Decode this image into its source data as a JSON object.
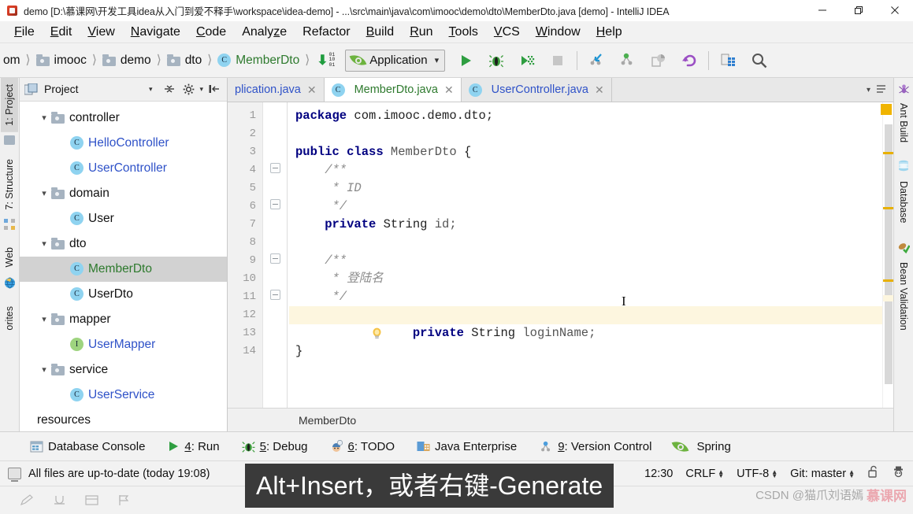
{
  "window": {
    "title": "demo [D:\\慕课网\\开发工具idea从入门到爱不释手\\workspace\\idea-demo] - ...\\src\\main\\java\\com\\imooc\\demo\\dto\\MemberDto.java [demo] - IntelliJ IDEA",
    "minimize_label": "─",
    "maximize_label": "❐",
    "close_label": "✕",
    "app_icon": "intellij-idea-icon"
  },
  "menubar": [
    {
      "label": "File",
      "accel": "F"
    },
    {
      "label": "Edit",
      "accel": "E"
    },
    {
      "label": "View",
      "accel": "V"
    },
    {
      "label": "Navigate",
      "accel": "N"
    },
    {
      "label": "Code",
      "accel": "C"
    },
    {
      "label": "Analyze",
      "accel": ""
    },
    {
      "label": "Refactor",
      "accel": ""
    },
    {
      "label": "Build",
      "accel": "B"
    },
    {
      "label": "Run",
      "accel": "R"
    },
    {
      "label": "Tools",
      "accel": "T"
    },
    {
      "label": "VCS",
      "accel": "V"
    },
    {
      "label": "Window",
      "accel": "W"
    },
    {
      "label": "Help",
      "accel": "H"
    }
  ],
  "navbar": {
    "breadcrumbs": [
      {
        "label": "om",
        "icon": "none",
        "style": "plain"
      },
      {
        "label": "imooc",
        "icon": "folder-icon",
        "style": "plain"
      },
      {
        "label": "demo",
        "icon": "folder-icon",
        "style": "plain"
      },
      {
        "label": "dto",
        "icon": "folder-icon",
        "style": "plain"
      },
      {
        "label": "MemberDto",
        "icon": "class-icon",
        "style": "green"
      }
    ],
    "compile_icon": "compile-binary-icon",
    "run_config": {
      "label": "Application",
      "icon": "spring-leaf-icon",
      "chevron": "⌄"
    },
    "buttons": [
      {
        "name": "run-button",
        "icon": "play-icon"
      },
      {
        "name": "debug-button",
        "icon": "bug-icon"
      },
      {
        "name": "run-coverage-button",
        "icon": "coverage-icon"
      },
      {
        "name": "stop-button",
        "icon": "stop-icon"
      },
      {
        "name": "update-project-button",
        "icon": "vcs-update-icon"
      },
      {
        "name": "commit-button",
        "icon": "vcs-commit-icon"
      },
      {
        "name": "compare-with-branch-button",
        "icon": "vcs-compare-icon"
      },
      {
        "name": "rollback-button",
        "icon": "vcs-revert-icon"
      },
      {
        "name": "database-button",
        "icon": "database-table-icon"
      },
      {
        "name": "search-everywhere-button",
        "icon": "search-icon"
      }
    ]
  },
  "left_strip": [
    {
      "label": "1: Project",
      "accel": "1",
      "icon": "project-icon",
      "active": true
    },
    {
      "label": "7: Structure",
      "accel": "7",
      "icon": "structure-icon",
      "active": false
    },
    {
      "label": "Web",
      "accel": "",
      "icon": "web-globe-icon",
      "active": false
    },
    {
      "label": "orites",
      "accel": "",
      "icon": "favorites-icon",
      "active": false
    }
  ],
  "right_strip": [
    {
      "label": "Ant Build",
      "icon": "ant-icon"
    },
    {
      "label": "Database",
      "icon": "database-icon"
    },
    {
      "label": "Bean Validation",
      "icon": "bean-validation-icon"
    }
  ],
  "project_panel": {
    "title": "Project",
    "caret": "▾",
    "tools": [
      {
        "name": "collapse-all-button",
        "icon": "collapse-all-icon"
      },
      {
        "name": "settings-button",
        "icon": "gear-icon"
      },
      {
        "name": "hide-panel-button",
        "icon": "hide-icon"
      }
    ],
    "tree": [
      {
        "label": "controller",
        "type": "folder",
        "indent": 0,
        "expanded": true,
        "style": "plain",
        "selected": false
      },
      {
        "label": "HelloController",
        "type": "class",
        "indent": 1,
        "expanded": null,
        "style": "link",
        "selected": false
      },
      {
        "label": "UserController",
        "type": "class",
        "indent": 1,
        "expanded": null,
        "style": "link",
        "selected": false
      },
      {
        "label": "domain",
        "type": "folder",
        "indent": 0,
        "expanded": true,
        "style": "plain",
        "selected": false
      },
      {
        "label": "User",
        "type": "class",
        "indent": 1,
        "expanded": null,
        "style": "plain",
        "selected": false
      },
      {
        "label": "dto",
        "type": "folder",
        "indent": 0,
        "expanded": true,
        "style": "plain",
        "selected": false
      },
      {
        "label": "MemberDto",
        "type": "class",
        "indent": 1,
        "expanded": null,
        "style": "green",
        "selected": true
      },
      {
        "label": "UserDto",
        "type": "class",
        "indent": 1,
        "expanded": null,
        "style": "plain",
        "selected": false
      },
      {
        "label": "mapper",
        "type": "folder",
        "indent": 0,
        "expanded": true,
        "style": "plain",
        "selected": false
      },
      {
        "label": "UserMapper",
        "type": "interface",
        "indent": 1,
        "expanded": null,
        "style": "link",
        "selected": false
      },
      {
        "label": "service",
        "type": "folder",
        "indent": 0,
        "expanded": true,
        "style": "plain",
        "selected": false
      },
      {
        "label": "UserService",
        "type": "class",
        "indent": 1,
        "expanded": null,
        "style": "link",
        "selected": false
      },
      {
        "label": "resources",
        "type": "folder-plain",
        "indent": 0,
        "expanded": null,
        "style": "plain",
        "selected": false
      }
    ]
  },
  "editor": {
    "tabs": [
      {
        "label": "plication.java",
        "style": "muted",
        "icon": "none",
        "active": false,
        "close": "✕"
      },
      {
        "label": "MemberDto.java",
        "style": "green",
        "icon": "class-icon",
        "active": true,
        "close": "✕"
      },
      {
        "label": "UserController.java",
        "style": "blue",
        "icon": "class-icon",
        "active": false,
        "close": "✕"
      }
    ],
    "line_numbers": [
      "1",
      "2",
      "3",
      "4",
      "5",
      "6",
      "7",
      "8",
      "9",
      "10",
      "11",
      "12",
      "13",
      "14"
    ],
    "lines": [
      {
        "n": 1,
        "tokens": [
          {
            "t": "package ",
            "c": "kw"
          },
          {
            "t": "com.imooc.demo.dto;",
            "c": "plain"
          }
        ],
        "highlight": false
      },
      {
        "n": 2,
        "tokens": [],
        "highlight": false
      },
      {
        "n": 3,
        "tokens": [
          {
            "t": "public class ",
            "c": "kw"
          },
          {
            "t": "MemberDto ",
            "c": "type"
          },
          {
            "t": "{",
            "c": "plain"
          }
        ],
        "highlight": false
      },
      {
        "n": 4,
        "tokens": [
          {
            "t": "    /**",
            "c": "cmt"
          }
        ],
        "highlight": false
      },
      {
        "n": 5,
        "tokens": [
          {
            "t": "     * ID",
            "c": "cmt"
          }
        ],
        "highlight": false
      },
      {
        "n": 6,
        "tokens": [
          {
            "t": "     */",
            "c": "cmt"
          }
        ],
        "highlight": false
      },
      {
        "n": 7,
        "tokens": [
          {
            "t": "    private ",
            "c": "kw"
          },
          {
            "t": "String ",
            "c": "plain"
          },
          {
            "t": "id;",
            "c": "type"
          }
        ],
        "highlight": false
      },
      {
        "n": 8,
        "tokens": [],
        "highlight": false
      },
      {
        "n": 9,
        "tokens": [
          {
            "t": "    /**",
            "c": "cmt"
          }
        ],
        "highlight": false
      },
      {
        "n": 10,
        "tokens": [
          {
            "t": "     * 登陆名",
            "c": "cmt"
          }
        ],
        "highlight": false
      },
      {
        "n": 11,
        "tokens": [
          {
            "t": "     */",
            "c": "cmt"
          }
        ],
        "highlight": false
      },
      {
        "n": 12,
        "tokens": [
          {
            "t": "    private ",
            "c": "kw"
          },
          {
            "t": "String ",
            "c": "plain"
          },
          {
            "t": "loginName;",
            "c": "type"
          }
        ],
        "highlight": true
      },
      {
        "n": 13,
        "tokens": [],
        "highlight": false
      },
      {
        "n": 14,
        "tokens": [
          {
            "t": "}",
            "c": "plain"
          }
        ],
        "highlight": false
      }
    ],
    "intention_bulb": {
      "line": 12,
      "icon": "lightbulb-icon"
    },
    "breadcrumb": "MemberDto",
    "tab_overflow_icon": "chevron-down-icon",
    "tab_list_icon": "list-icon"
  },
  "tool_windows": [
    {
      "label": "Database Console",
      "accel": "",
      "icon": "database-console-icon"
    },
    {
      "label": "4: Run",
      "accel": "4",
      "icon": "play-icon"
    },
    {
      "label": "5: Debug",
      "accel": "5",
      "icon": "bug-icon"
    },
    {
      "label": "6: TODO",
      "accel": "6",
      "icon": "todo-icon"
    },
    {
      "label": "Java Enterprise",
      "accel": "",
      "icon": "java-enterprise-icon"
    },
    {
      "label": "9: Version Control",
      "accel": "9",
      "icon": "vcs-icon"
    },
    {
      "label": "Spring",
      "accel": "",
      "icon": "spring-leaf-icon"
    }
  ],
  "statusbar": {
    "message": "All files are up-to-date (today 19:08)",
    "message_icon": "monitor-icon",
    "position": "12:30",
    "line_separator": "CRLF",
    "encoding": "UTF-8",
    "branch": "Git: master",
    "lock_icon": "unlocked-padlock-icon",
    "inspection_icon": "inspector-hat-icon"
  },
  "bottom_strip": [
    {
      "name": "pencil-icon"
    },
    {
      "name": "underline-icon"
    },
    {
      "name": "layout-icon"
    },
    {
      "name": "flag-icon"
    }
  ],
  "subtitle": {
    "text": "Alt+Insert，或者右键-Generate"
  },
  "watermark": {
    "text": "CSDN @猫爪刘语嫣",
    "mark": "慕课网"
  },
  "colors": {
    "accent_green": "#2e7a2e",
    "link_blue": "#2f52c8",
    "keyword_navy": "#000080",
    "warning_yellow": "#e8b000",
    "selection_gray": "#d2d2d2",
    "current_line": "#fdf6df"
  }
}
